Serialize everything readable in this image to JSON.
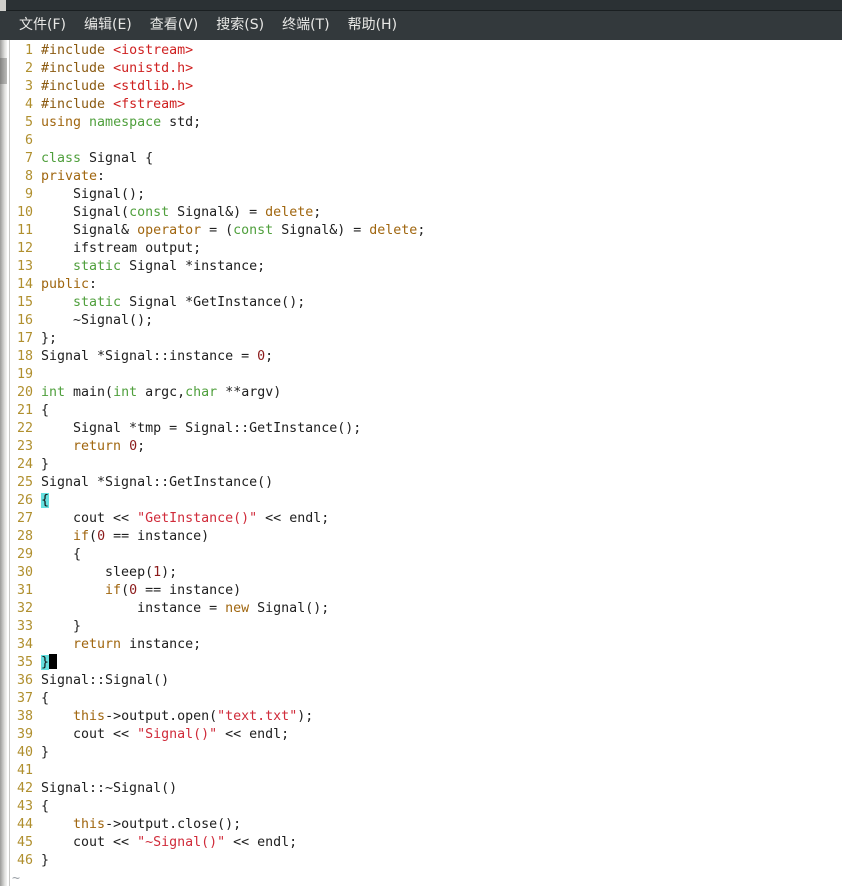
{
  "window": {
    "titlebar_color": "#2b3134",
    "menubar_color": "#33393c",
    "editor_background": "#ffffff"
  },
  "menubar": {
    "items": [
      {
        "label": "文件(F)",
        "name": "menu-file"
      },
      {
        "label": "编辑(E)",
        "name": "menu-edit"
      },
      {
        "label": "查看(V)",
        "name": "menu-view"
      },
      {
        "label": "搜索(S)",
        "name": "menu-search"
      },
      {
        "label": "终端(T)",
        "name": "menu-terminal"
      },
      {
        "label": "帮助(H)",
        "name": "menu-help"
      }
    ]
  },
  "editor": {
    "eof_marker": "~",
    "colors": {
      "line_number": "#b08f2e",
      "preprocessor": "#8b5a11",
      "header": "#cf2020",
      "keyword": "#a0660f",
      "type": "#4f9f3c",
      "string": "#d02b3a",
      "number": "#8b1a1a",
      "plain": "#202020",
      "bracket_match_highlight": "#66e0e0",
      "cursor": "#000000"
    },
    "lines": [
      {
        "n": "1",
        "tokens": [
          {
            "t": "#include ",
            "c": "pre"
          },
          {
            "t": "<iostream>",
            "c": "hdr"
          }
        ]
      },
      {
        "n": "2",
        "tokens": [
          {
            "t": "#include ",
            "c": "pre"
          },
          {
            "t": "<unistd.h>",
            "c": "hdr"
          }
        ]
      },
      {
        "n": "3",
        "tokens": [
          {
            "t": "#include ",
            "c": "pre"
          },
          {
            "t": "<stdlib.h>",
            "c": "hdr"
          }
        ]
      },
      {
        "n": "4",
        "tokens": [
          {
            "t": "#include ",
            "c": "pre"
          },
          {
            "t": "<fstream>",
            "c": "hdr"
          }
        ]
      },
      {
        "n": "5",
        "tokens": [
          {
            "t": "using",
            "c": "kw"
          },
          {
            "t": " ",
            "c": "plain"
          },
          {
            "t": "namespace",
            "c": "type"
          },
          {
            "t": " std;",
            "c": "plain"
          }
        ]
      },
      {
        "n": "6",
        "tokens": []
      },
      {
        "n": "7",
        "tokens": [
          {
            "t": "class",
            "c": "type"
          },
          {
            "t": " Signal {",
            "c": "plain"
          }
        ]
      },
      {
        "n": "8",
        "tokens": [
          {
            "t": "private",
            "c": "kw"
          },
          {
            "t": ":",
            "c": "plain"
          }
        ]
      },
      {
        "n": "9",
        "tokens": [
          {
            "t": "    Signal();",
            "c": "plain"
          }
        ]
      },
      {
        "n": "10",
        "tokens": [
          {
            "t": "    Signal(",
            "c": "plain"
          },
          {
            "t": "const",
            "c": "type"
          },
          {
            "t": " Signal&) = ",
            "c": "plain"
          },
          {
            "t": "delete",
            "c": "kw"
          },
          {
            "t": ";",
            "c": "plain"
          }
        ]
      },
      {
        "n": "11",
        "tokens": [
          {
            "t": "    Signal& ",
            "c": "plain"
          },
          {
            "t": "operator",
            "c": "kw"
          },
          {
            "t": " = (",
            "c": "plain"
          },
          {
            "t": "const",
            "c": "type"
          },
          {
            "t": " Signal&) = ",
            "c": "plain"
          },
          {
            "t": "delete",
            "c": "kw"
          },
          {
            "t": ";",
            "c": "plain"
          }
        ]
      },
      {
        "n": "12",
        "tokens": [
          {
            "t": "    ifstream output;",
            "c": "plain"
          }
        ]
      },
      {
        "n": "13",
        "tokens": [
          {
            "t": "    ",
            "c": "plain"
          },
          {
            "t": "static",
            "c": "type"
          },
          {
            "t": " Signal *instance;",
            "c": "plain"
          }
        ]
      },
      {
        "n": "14",
        "tokens": [
          {
            "t": "public",
            "c": "kw"
          },
          {
            "t": ":",
            "c": "plain"
          }
        ]
      },
      {
        "n": "15",
        "tokens": [
          {
            "t": "    ",
            "c": "plain"
          },
          {
            "t": "static",
            "c": "type"
          },
          {
            "t": " Signal *GetInstance();",
            "c": "plain"
          }
        ]
      },
      {
        "n": "16",
        "tokens": [
          {
            "t": "    ~Signal();",
            "c": "plain"
          }
        ]
      },
      {
        "n": "17",
        "tokens": [
          {
            "t": "};",
            "c": "plain"
          }
        ]
      },
      {
        "n": "18",
        "tokens": [
          {
            "t": "Signal *Signal::instance = ",
            "c": "plain"
          },
          {
            "t": "0",
            "c": "num"
          },
          {
            "t": ";",
            "c": "plain"
          }
        ]
      },
      {
        "n": "19",
        "tokens": []
      },
      {
        "n": "20",
        "tokens": [
          {
            "t": "int",
            "c": "type"
          },
          {
            "t": " main(",
            "c": "plain"
          },
          {
            "t": "int",
            "c": "type"
          },
          {
            "t": " argc,",
            "c": "plain"
          },
          {
            "t": "char",
            "c": "type"
          },
          {
            "t": " **argv)",
            "c": "plain"
          }
        ]
      },
      {
        "n": "21",
        "tokens": [
          {
            "t": "{",
            "c": "plain"
          }
        ]
      },
      {
        "n": "22",
        "tokens": [
          {
            "t": "    Signal *tmp = Signal::GetInstance();",
            "c": "plain"
          }
        ]
      },
      {
        "n": "23",
        "tokens": [
          {
            "t": "    ",
            "c": "plain"
          },
          {
            "t": "return",
            "c": "kw"
          },
          {
            "t": " ",
            "c": "plain"
          },
          {
            "t": "0",
            "c": "num"
          },
          {
            "t": ";",
            "c": "plain"
          }
        ]
      },
      {
        "n": "24",
        "tokens": [
          {
            "t": "}",
            "c": "plain"
          }
        ]
      },
      {
        "n": "25",
        "tokens": [
          {
            "t": "Signal *Signal::GetInstance()",
            "c": "plain"
          }
        ]
      },
      {
        "n": "26",
        "tokens": [
          {
            "t": "{",
            "c": "plain",
            "match": true
          }
        ]
      },
      {
        "n": "27",
        "tokens": [
          {
            "t": "    cout << ",
            "c": "plain"
          },
          {
            "t": "\"GetInstance()\"",
            "c": "str"
          },
          {
            "t": " << endl;",
            "c": "plain"
          }
        ]
      },
      {
        "n": "28",
        "tokens": [
          {
            "t": "    ",
            "c": "plain"
          },
          {
            "t": "if",
            "c": "kw"
          },
          {
            "t": "(",
            "c": "plain"
          },
          {
            "t": "0",
            "c": "num"
          },
          {
            "t": " == instance)",
            "c": "plain"
          }
        ]
      },
      {
        "n": "29",
        "tokens": [
          {
            "t": "    {",
            "c": "plain"
          }
        ]
      },
      {
        "n": "30",
        "tokens": [
          {
            "t": "        sleep(",
            "c": "plain"
          },
          {
            "t": "1",
            "c": "num"
          },
          {
            "t": ");",
            "c": "plain"
          }
        ]
      },
      {
        "n": "31",
        "tokens": [
          {
            "t": "        ",
            "c": "plain"
          },
          {
            "t": "if",
            "c": "kw"
          },
          {
            "t": "(",
            "c": "plain"
          },
          {
            "t": "0",
            "c": "num"
          },
          {
            "t": " == instance)",
            "c": "plain"
          }
        ]
      },
      {
        "n": "32",
        "tokens": [
          {
            "t": "            instance = ",
            "c": "plain"
          },
          {
            "t": "new",
            "c": "kw"
          },
          {
            "t": " Signal();",
            "c": "plain"
          }
        ]
      },
      {
        "n": "33",
        "tokens": [
          {
            "t": "    }",
            "c": "plain"
          }
        ]
      },
      {
        "n": "34",
        "tokens": [
          {
            "t": "    ",
            "c": "plain"
          },
          {
            "t": "return",
            "c": "kw"
          },
          {
            "t": " instance;",
            "c": "plain"
          }
        ]
      },
      {
        "n": "35",
        "tokens": [
          {
            "t": "}",
            "c": "plain",
            "match": true
          }
        ],
        "cursor": true
      },
      {
        "n": "36",
        "tokens": [
          {
            "t": "Signal::Signal()",
            "c": "plain"
          }
        ]
      },
      {
        "n": "37",
        "tokens": [
          {
            "t": "{",
            "c": "plain"
          }
        ]
      },
      {
        "n": "38",
        "tokens": [
          {
            "t": "    ",
            "c": "plain"
          },
          {
            "t": "this",
            "c": "kw"
          },
          {
            "t": "->output.open(",
            "c": "plain"
          },
          {
            "t": "\"text.txt\"",
            "c": "str"
          },
          {
            "t": ");",
            "c": "plain"
          }
        ]
      },
      {
        "n": "39",
        "tokens": [
          {
            "t": "    cout << ",
            "c": "plain"
          },
          {
            "t": "\"Signal()\"",
            "c": "str"
          },
          {
            "t": " << endl;",
            "c": "plain"
          }
        ]
      },
      {
        "n": "40",
        "tokens": [
          {
            "t": "}",
            "c": "plain"
          }
        ]
      },
      {
        "n": "41",
        "tokens": []
      },
      {
        "n": "42",
        "tokens": [
          {
            "t": "Signal::~Signal()",
            "c": "plain"
          }
        ]
      },
      {
        "n": "43",
        "tokens": [
          {
            "t": "{",
            "c": "plain"
          }
        ]
      },
      {
        "n": "44",
        "tokens": [
          {
            "t": "    ",
            "c": "plain"
          },
          {
            "t": "this",
            "c": "kw"
          },
          {
            "t": "->output.close();",
            "c": "plain"
          }
        ]
      },
      {
        "n": "45",
        "tokens": [
          {
            "t": "    cout << ",
            "c": "plain"
          },
          {
            "t": "\"~Signal()\"",
            "c": "str"
          },
          {
            "t": " << endl;",
            "c": "plain"
          }
        ]
      },
      {
        "n": "46",
        "tokens": [
          {
            "t": "}",
            "c": "plain"
          }
        ]
      }
    ]
  }
}
